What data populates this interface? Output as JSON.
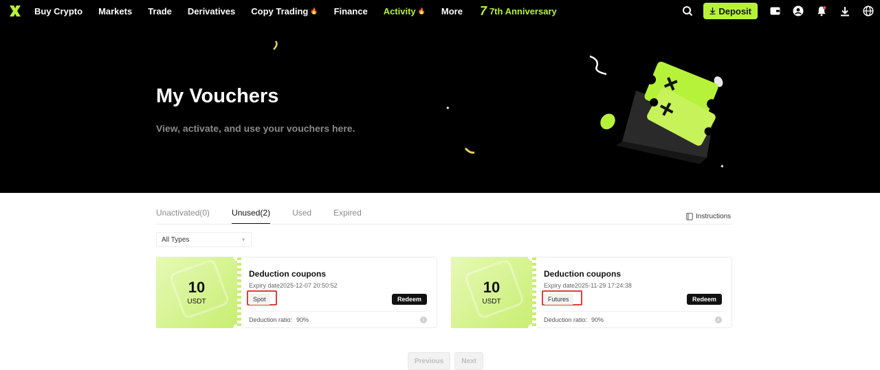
{
  "nav": {
    "items": [
      {
        "label": "Buy Crypto",
        "hot": false,
        "accent": false
      },
      {
        "label": "Markets",
        "hot": false,
        "accent": false
      },
      {
        "label": "Trade",
        "hot": false,
        "accent": false
      },
      {
        "label": "Derivatives",
        "hot": false,
        "accent": false
      },
      {
        "label": "Copy Trading",
        "hot": true,
        "accent": false
      },
      {
        "label": "Finance",
        "hot": false,
        "accent": false
      },
      {
        "label": "Activity",
        "hot": true,
        "accent": true
      },
      {
        "label": "More",
        "hot": false,
        "accent": false
      }
    ],
    "anniversary_number": "7",
    "anniversary_label": "7th Anniversary",
    "deposit_label": "Deposit",
    "accent_color": "#b7f23a",
    "icons": [
      "search-icon",
      "wallet-icon",
      "user-icon",
      "bell-icon",
      "download-icon",
      "globe-icon"
    ]
  },
  "hero": {
    "title": "My Vouchers",
    "subtitle": "View, activate, and use your vouchers here."
  },
  "tabs": [
    {
      "label": "Unactivated(0)",
      "active": false
    },
    {
      "label": "Unused(2)",
      "active": true
    },
    {
      "label": "Used",
      "active": false
    },
    {
      "label": "Expired",
      "active": false
    }
  ],
  "instructions_label": "Instructions",
  "filter": {
    "selected": "All Types"
  },
  "vouchers": [
    {
      "amount": "10",
      "unit": "USDT",
      "title": "Deduction coupons",
      "expiry": "Expiry date2025-12-07 20:50:52",
      "tag": "Spot",
      "redeem_label": "Redeem",
      "ratio_label": "Deduction ratio:",
      "ratio_value": "90%"
    },
    {
      "amount": "10",
      "unit": "USDT",
      "title": "Deduction coupons",
      "expiry": "Expiry date2025-11-29 17:24:38",
      "tag": "Futures",
      "redeem_label": "Redeem",
      "ratio_label": "Deduction ratio:",
      "ratio_value": "90%"
    }
  ],
  "pagination": {
    "previous": "Previous",
    "next": "Next"
  }
}
